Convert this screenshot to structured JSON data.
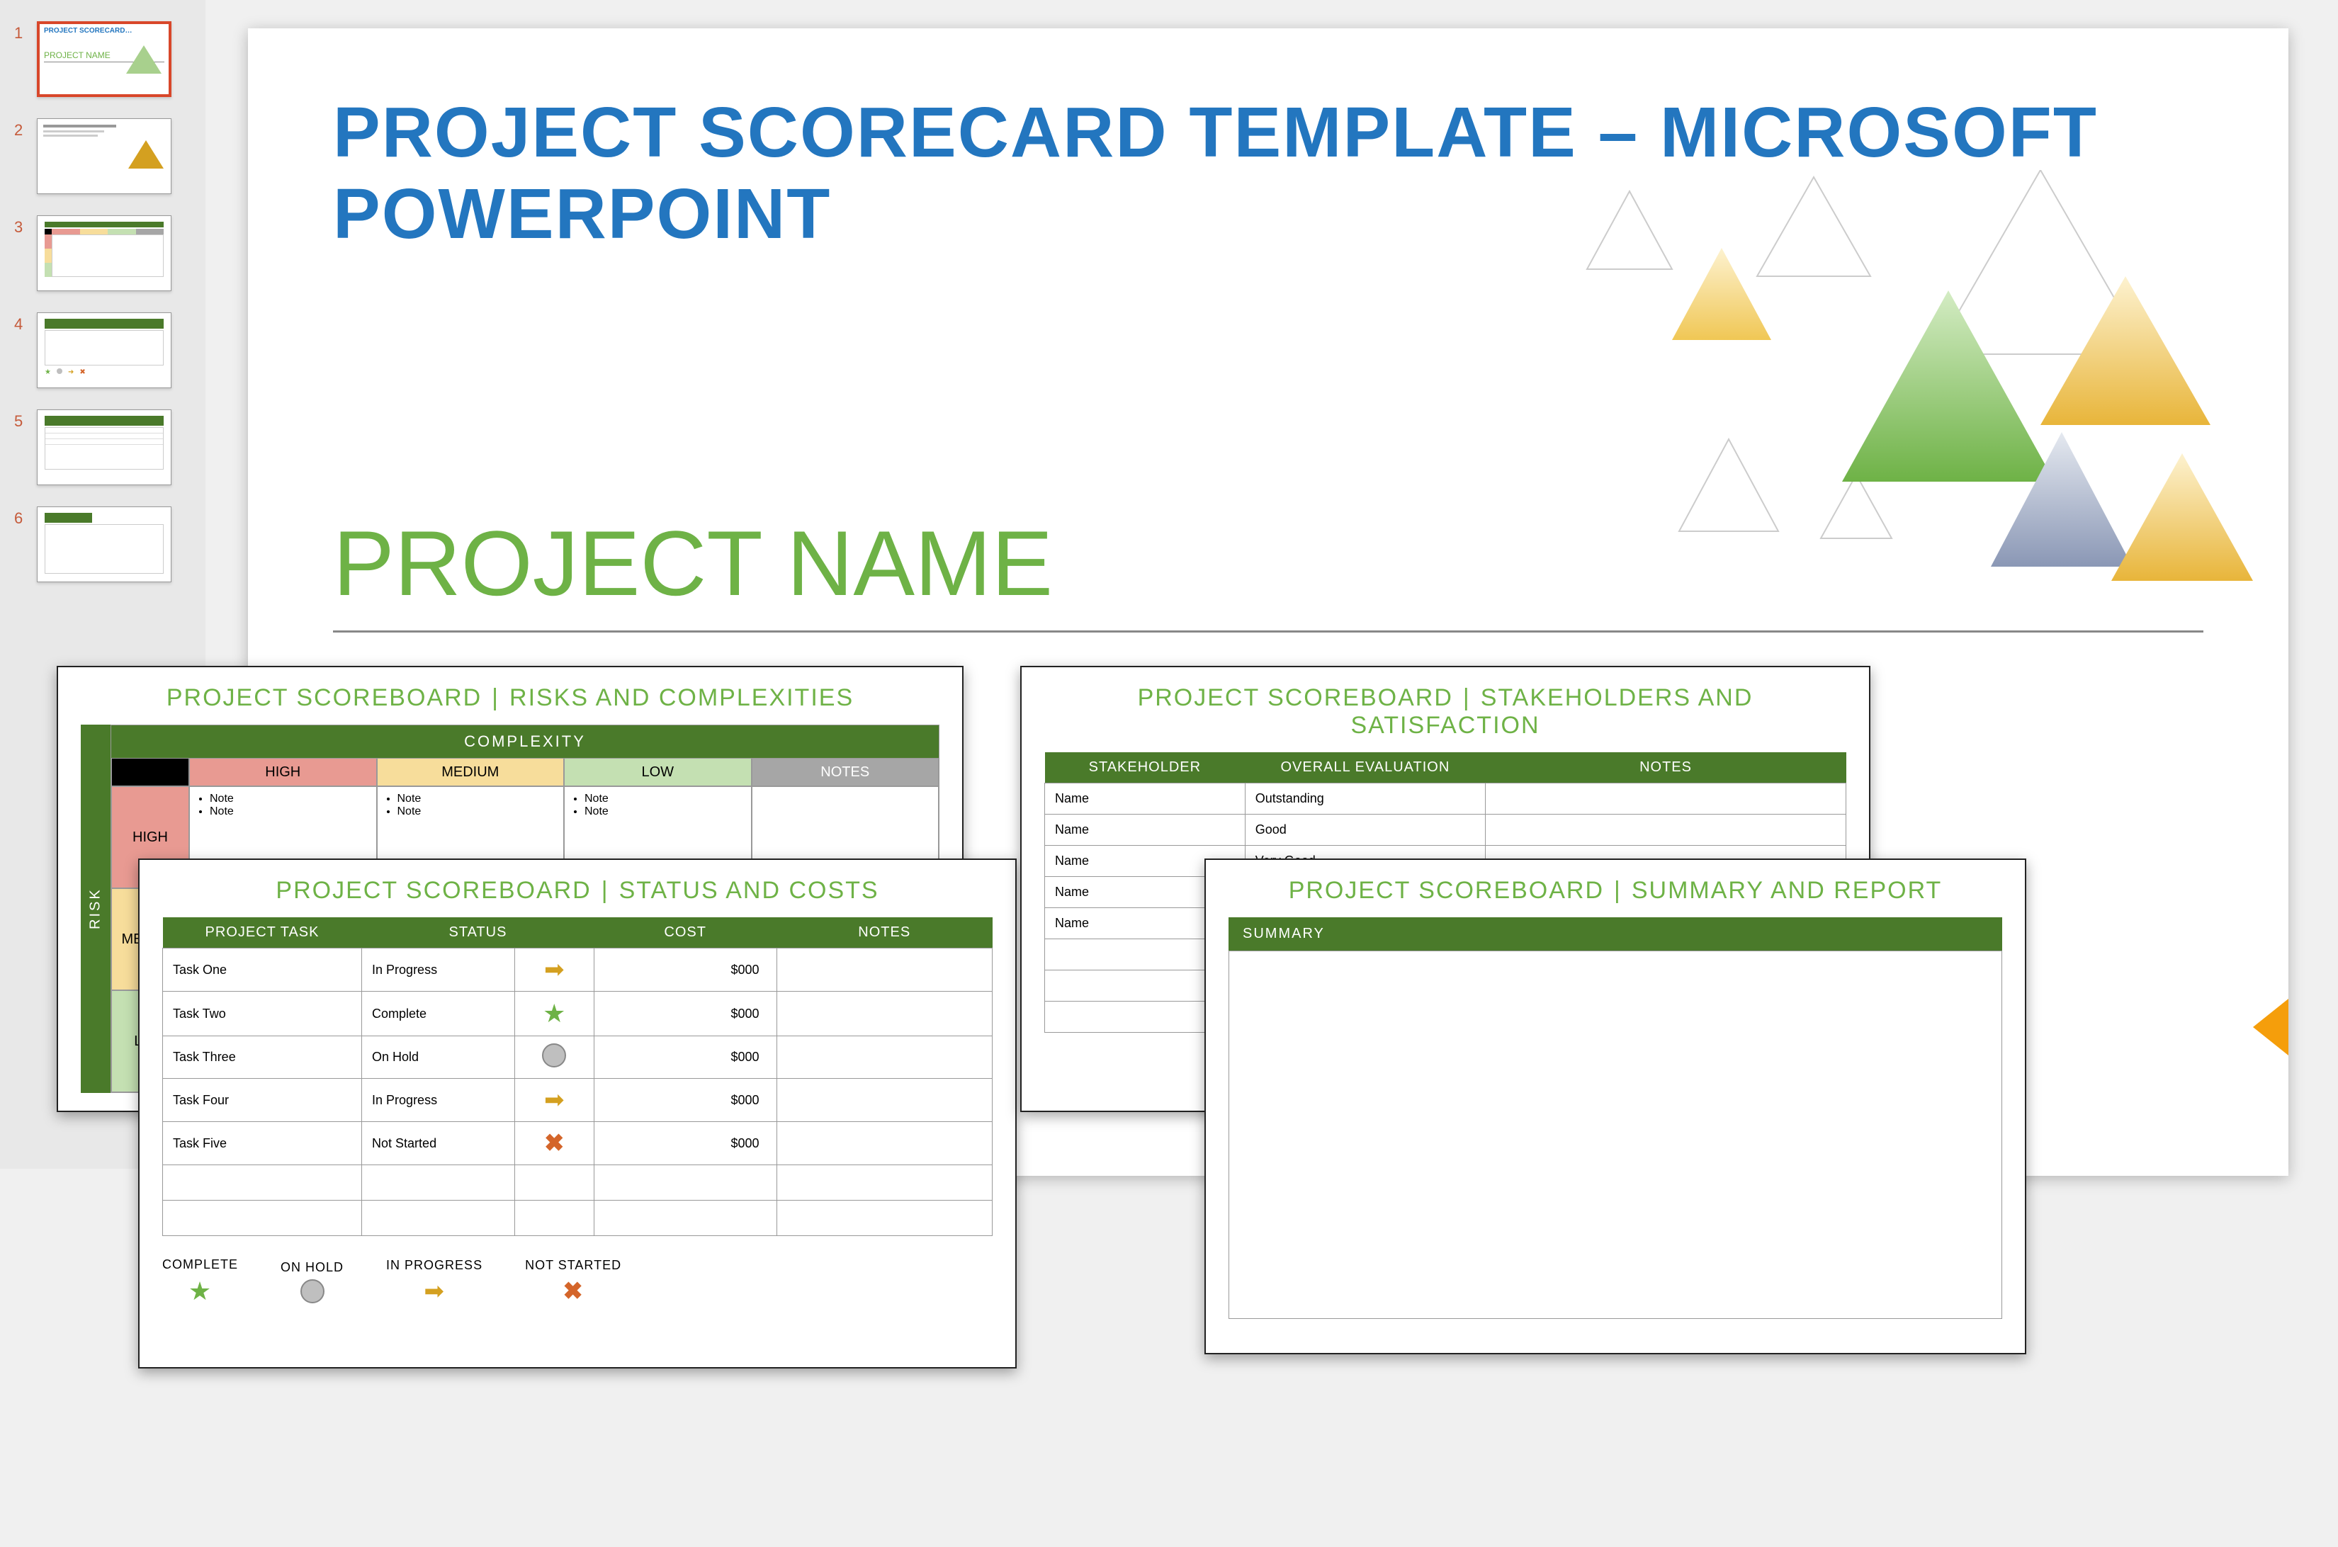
{
  "thumbnails": [
    "1",
    "2",
    "3",
    "4",
    "5",
    "6"
  ],
  "main": {
    "title": "PROJECT SCORECARD TEMPLATE – MICROSOFT POWERPOINT",
    "project_name": "PROJECT NAME"
  },
  "risks": {
    "title_a": "PROJECT SCOREBOARD",
    "title_b": "RISKS AND COMPLEXITIES",
    "axis_v": "RISK",
    "axis_h": "COMPLEXITY",
    "headers": {
      "high": "HIGH",
      "medium": "MEDIUM",
      "low": "LOW",
      "notes": "NOTES"
    },
    "row_labels": {
      "high": "HIGH",
      "medium": "MEDIUM",
      "low": "LOW"
    },
    "note_label": "Note"
  },
  "status": {
    "title_a": "PROJECT SCOREBOARD",
    "title_b": "STATUS AND COSTS",
    "headers": {
      "task": "PROJECT TASK",
      "status": "STATUS",
      "cost": "COST",
      "notes": "NOTES"
    },
    "rows": [
      {
        "task": "Task One",
        "status": "In Progress",
        "icon": "arrow",
        "cost": "$000"
      },
      {
        "task": "Task Two",
        "status": "Complete",
        "icon": "star",
        "cost": "$000"
      },
      {
        "task": "Task Three",
        "status": "On Hold",
        "icon": "circle",
        "cost": "$000"
      },
      {
        "task": "Task Four",
        "status": "In Progress",
        "icon": "arrow",
        "cost": "$000"
      },
      {
        "task": "Task Five",
        "status": "Not Started",
        "icon": "x",
        "cost": "$000"
      }
    ],
    "legend": {
      "complete": "COMPLETE",
      "onhold": "ON HOLD",
      "inprogress": "IN PROGRESS",
      "notstarted": "NOT STARTED"
    }
  },
  "stake": {
    "title_a": "PROJECT SCOREBOARD",
    "title_b": "STAKEHOLDERS AND SATISFACTION",
    "headers": {
      "name": "STAKEHOLDER",
      "eval": "OVERALL EVALUATION",
      "notes": "NOTES"
    },
    "rows": [
      {
        "name": "Name",
        "eval": "Outstanding"
      },
      {
        "name": "Name",
        "eval": "Good"
      },
      {
        "name": "Name",
        "eval": "Very Good"
      },
      {
        "name": "Name",
        "eval": ""
      },
      {
        "name": "Name",
        "eval": ""
      }
    ]
  },
  "summary": {
    "title_a": "PROJECT SCOREBOARD",
    "title_b": "SUMMARY AND REPORT",
    "header": "SUMMARY"
  }
}
